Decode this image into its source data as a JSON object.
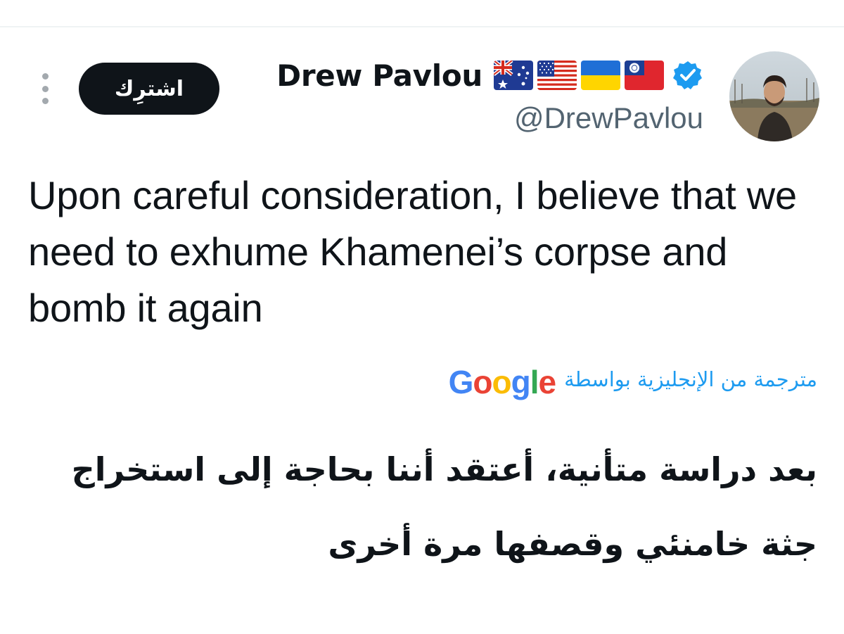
{
  "tweet": {
    "author": {
      "display_name": "Drew Pavlou",
      "handle": "@DrewPavlou",
      "verified": true,
      "flags": [
        "flag-australia-icon",
        "flag-usa-icon",
        "flag-ukraine-icon",
        "flag-taiwan-icon"
      ]
    },
    "subscribe_label": "اشترِك",
    "more_icon": "more-vertical-icon",
    "text": "Upon careful consideration, I believe that we need to exhume Khamenei’s corpse and bomb it again",
    "translation": {
      "label": "مترجمة من الإنجليزية بواسطة",
      "provider": "Google",
      "text": "بعد دراسة متأنية، أعتقد أننا بحاجة إلى استخراج جثة خامنئي وقصفها مرة أخرى"
    }
  },
  "colors": {
    "accent": "#1d9bf0",
    "text": "#0f1419",
    "secondary_text": "#536471",
    "button_bg": "#0f1419"
  }
}
